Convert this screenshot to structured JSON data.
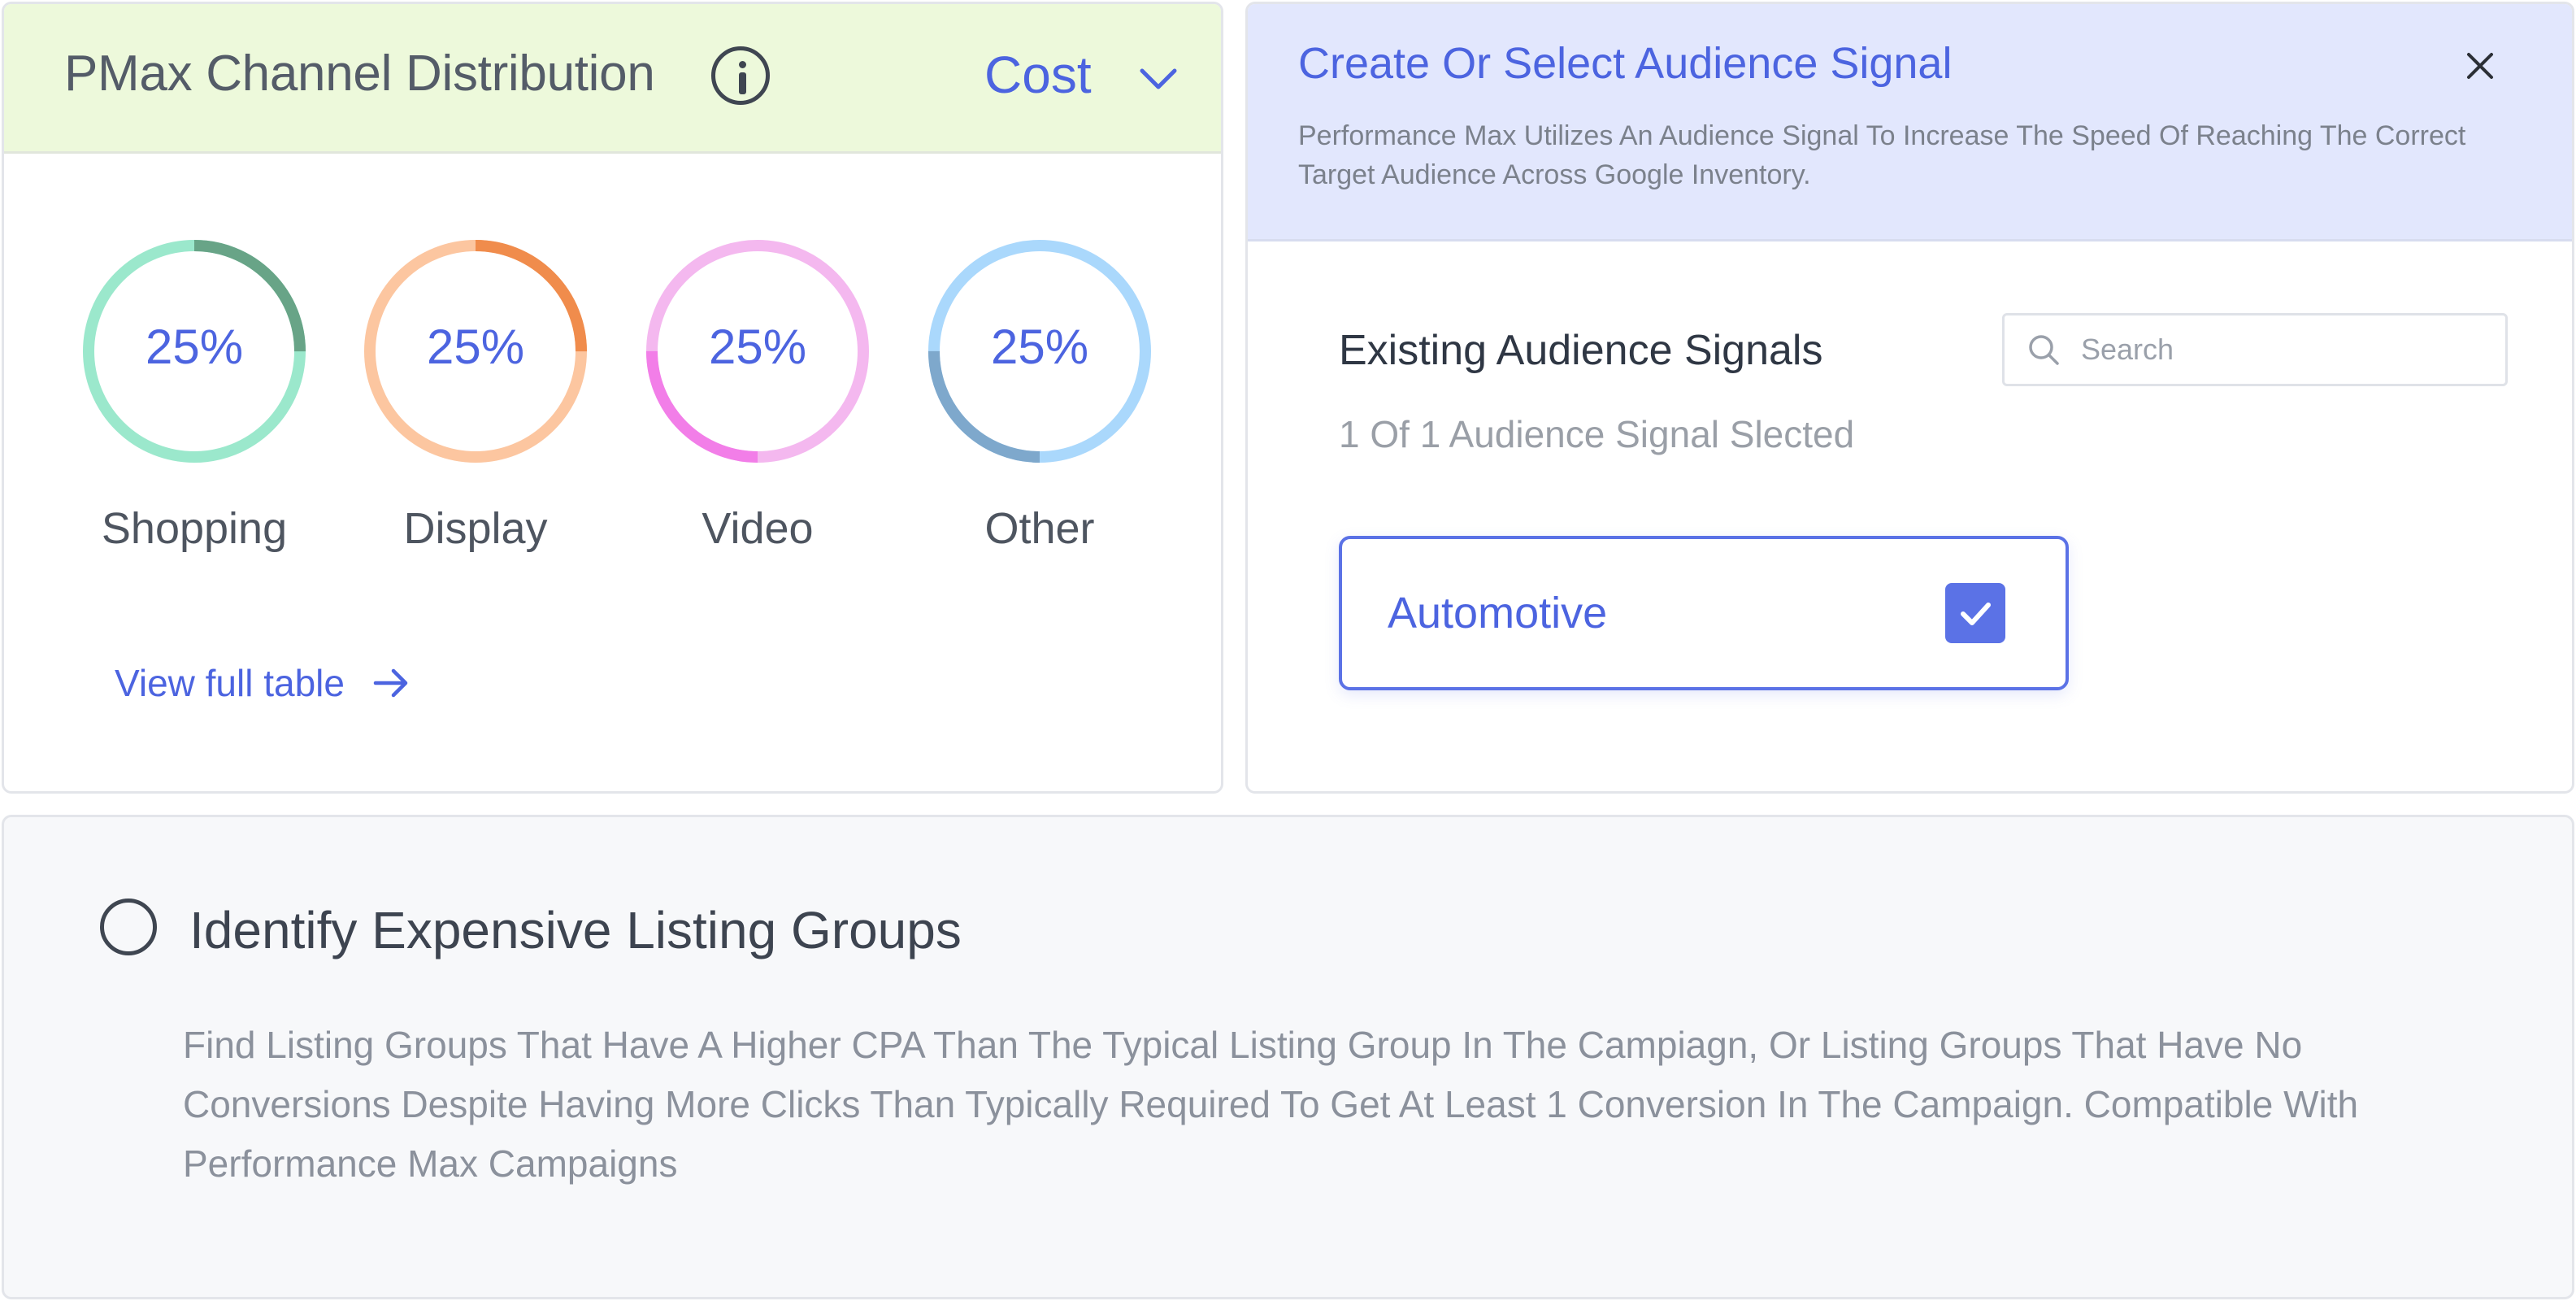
{
  "channel_distribution": {
    "title": "PMax Channel Distribution",
    "info_icon": "info-icon",
    "metric_selector": {
      "selected": "Cost",
      "icon": "chevron-down-icon"
    },
    "channels": [
      {
        "label": "Shopping",
        "percent_text": "25%",
        "percent": 25,
        "track_color": "#9be8cc",
        "arc_color": "#68a487"
      },
      {
        "label": "Display",
        "percent_text": "25%",
        "percent": 25,
        "track_color": "#fcc6a0",
        "arc_color": "#f08c4c"
      },
      {
        "label": "Video",
        "percent_text": "25%",
        "percent": 25,
        "track_color": "#f4b8ef",
        "arc_color": "#f27ee8"
      },
      {
        "label": "Other",
        "percent_text": "25%",
        "percent": 25,
        "track_color": "#aad8fc",
        "arc_color": "#7ea8cc"
      }
    ],
    "percent_text_color": "#4c64e0",
    "view_full_link": {
      "label": "View full table",
      "icon": "arrow-right-icon"
    }
  },
  "audience_signal": {
    "title": "Create Or Select Audience Signal",
    "description": "Performance Max Utilizes An Audience Signal To Increase The Speed Of Reaching The Correct Target Audience Across Google Inventory.",
    "close_icon": "close-icon",
    "existing_title": "Existing Audience Signals",
    "selected_count_text": "1 Of 1 Audience Signal Slected",
    "search": {
      "placeholder": "Search",
      "value": "",
      "icon": "search-icon"
    },
    "signals": [
      {
        "name": "Automotive",
        "checked": true
      }
    ],
    "accent_color": "#4c64e0"
  },
  "listing_groups": {
    "title": "Identify Expensive Listing Groups",
    "description": "Find Listing Groups That Have A Higher CPA Than The Typical Listing Group In The Campiagn, Or Listing Groups That Have No Conversions Despite Having More Clicks Than Typically Required To Get At Least 1 Conversion In The Campaign. Compatible With Performance Max Campaigns",
    "radio_selected": false
  }
}
